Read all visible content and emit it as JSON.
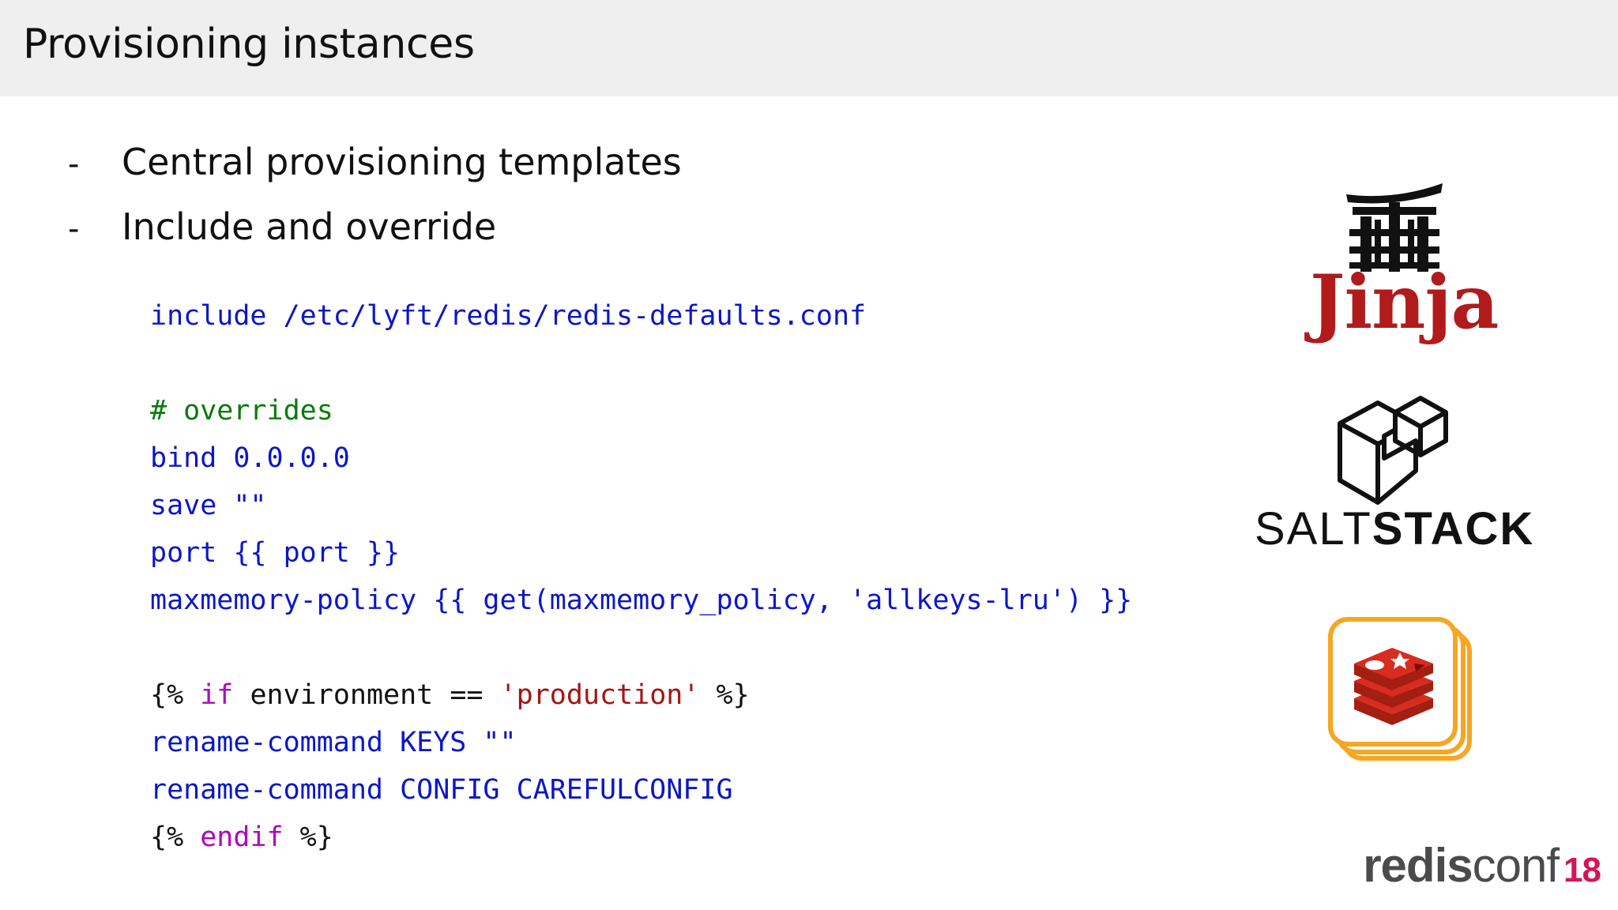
{
  "slide": {
    "title": "Provisioning instances",
    "bullets": [
      {
        "dash": "-",
        "text": "Central provisioning templates"
      },
      {
        "dash": "-",
        "text": "Include and override"
      }
    ]
  },
  "code": {
    "line1": "include /etc/lyft/redis/redis-defaults.conf",
    "comment": "# overrides",
    "bind": "bind 0.0.0.0",
    "save": "save \"\"",
    "port": "port {{ port }}",
    "maxmemory": "maxmemory-policy {{ get(maxmemory_policy, 'allkeys-lru') }}",
    "if_open": "{%",
    "if_kw": "if",
    "if_cond": "environment ==",
    "if_str": "'production'",
    "if_close": "%}",
    "rename_keys": "rename-command KEYS \"\"",
    "rename_config": "rename-command CONFIG CAREFULCONFIG",
    "endif_open": "{%",
    "endif_kw": "endif",
    "endif_close": "%}"
  },
  "logos": {
    "jinja": "Jinja",
    "saltstack_a": "SALT",
    "saltstack_b": "STACK",
    "redisconf_a": "redis",
    "redisconf_b": "conf",
    "redisconf_c": "18"
  },
  "colors": {
    "code_blue": "#0b17c8",
    "comment_green": "#0a7a0a",
    "keyword_purple": "#b000c0",
    "string_red": "#a31515",
    "jinja_red": "#b11b1b",
    "redis_red": "#c6302b",
    "orange_frame": "#f5a623",
    "accent_pink": "#d4145a"
  },
  "icons": [
    "torii-gate-icon",
    "saltstack-cube-icon",
    "redis-logo-icon"
  ]
}
